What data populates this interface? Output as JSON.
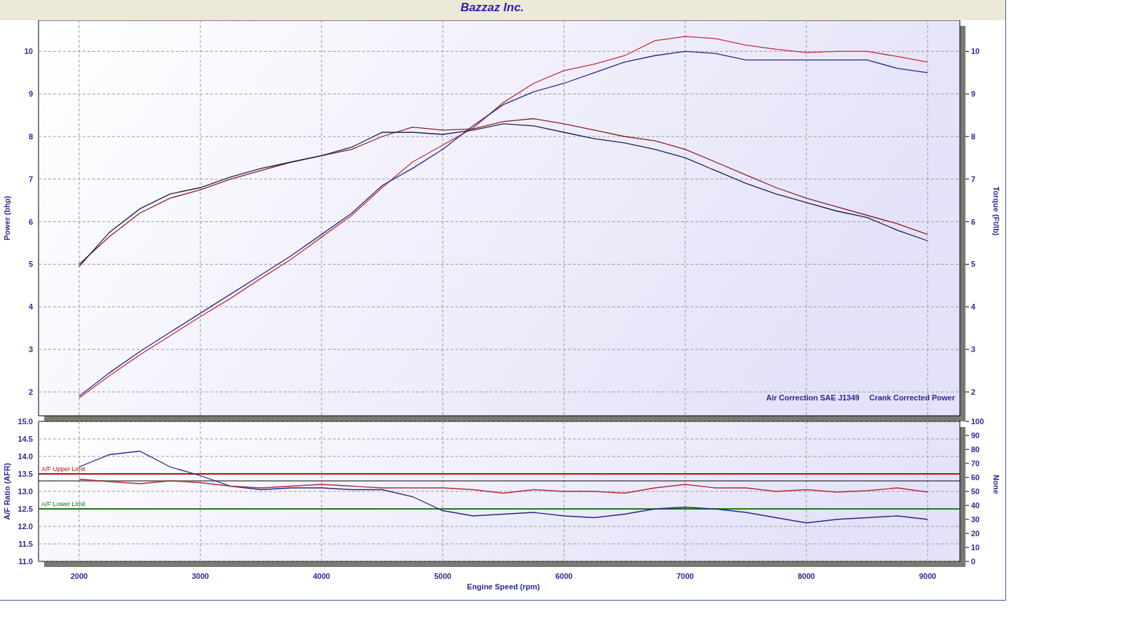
{
  "window": {
    "title": "Bazzaz Inc."
  },
  "power_chart": {
    "right_axis": {
      "label": "Torque (Ft/lb)",
      "ticks": [
        "10",
        "9",
        "8",
        "7",
        "6",
        "5",
        "4",
        "3",
        "2"
      ]
    },
    "notes": [
      "Air Correction SAE J1349",
      "Crank Corrected Power"
    ],
    "chart_data": {
      "type": "line",
      "ylabel": "Power (bhp)",
      "x": [
        2000,
        2250,
        2500,
        2750,
        3000,
        3250,
        3500,
        3750,
        4000,
        4250,
        4500,
        4750,
        5000,
        5250,
        5500,
        5750,
        6000,
        6250,
        6500,
        6750,
        7000,
        7250,
        7500,
        7750,
        8000,
        8250,
        8500,
        8750,
        9000
      ],
      "xlim": [
        1665,
        9266
      ],
      "ylim": [
        1.44,
        10.73
      ],
      "yticks": [
        2,
        3,
        4,
        5,
        6,
        7,
        8,
        9,
        10
      ],
      "grid": true,
      "series": [
        {
          "color": "#c42a3a",
          "values": [
            1.86,
            2.38,
            2.87,
            3.32,
            3.77,
            4.2,
            4.67,
            5.12,
            5.64,
            6.15,
            6.8,
            7.4,
            7.8,
            8.2,
            8.8,
            9.25,
            9.55,
            9.7,
            9.9,
            10.25,
            10.35,
            10.3,
            10.15,
            10.05,
            9.97,
            10.0,
            10.0,
            9.88,
            9.75
          ]
        },
        {
          "color": "#24248e",
          "values": [
            1.9,
            2.45,
            2.95,
            3.4,
            3.85,
            4.3,
            4.75,
            5.2,
            5.7,
            6.2,
            6.85,
            7.25,
            7.7,
            8.25,
            8.75,
            9.05,
            9.25,
            9.5,
            9.75,
            9.9,
            10.0,
            9.95,
            9.8,
            9.8,
            9.8,
            9.8,
            9.8,
            9.6,
            9.5
          ]
        },
        {
          "color": "#8a1c24",
          "values": [
            5.0,
            5.65,
            6.2,
            6.55,
            6.75,
            7.0,
            7.2,
            7.4,
            7.55,
            7.7,
            8.0,
            8.22,
            8.15,
            8.18,
            8.35,
            8.42,
            8.3,
            8.15,
            8.0,
            7.9,
            7.7,
            7.4,
            7.1,
            6.8,
            6.55,
            6.35,
            6.15,
            5.95,
            5.7
          ]
        },
        {
          "color": "#1c1c50",
          "values": [
            4.95,
            5.75,
            6.3,
            6.65,
            6.8,
            7.05,
            7.25,
            7.4,
            7.55,
            7.75,
            8.1,
            8.1,
            8.05,
            8.15,
            8.3,
            8.25,
            8.1,
            7.95,
            7.85,
            7.7,
            7.5,
            7.2,
            6.9,
            6.65,
            6.45,
            6.25,
            6.1,
            5.8,
            5.55
          ]
        }
      ]
    }
  },
  "afr_chart": {
    "right_axis": {
      "label": "None",
      "ticks": [
        "100",
        "90",
        "80",
        "70",
        "60",
        "50",
        "40",
        "30",
        "20",
        "10",
        "0"
      ]
    },
    "chart_data": {
      "type": "line",
      "xlabel": "Engine Speed (rpm)",
      "ylabel": "A/F Ratio (AFR)",
      "x": [
        2000,
        2250,
        2500,
        2750,
        3000,
        3250,
        3500,
        3750,
        4000,
        4250,
        4500,
        4750,
        5000,
        5250,
        5500,
        5750,
        6000,
        6250,
        6500,
        6750,
        7000,
        7250,
        7500,
        7750,
        8000,
        8250,
        8500,
        8750,
        9000
      ],
      "xlim": [
        1665,
        9266
      ],
      "ylim": [
        11,
        15
      ],
      "grid": true,
      "xticks": [
        2000,
        3000,
        4000,
        5000,
        6000,
        7000,
        8000,
        9000
      ],
      "yticks": [
        {
          "value": 11,
          "label": "11.0"
        },
        {
          "value": 11.5,
          "label": "11.5"
        },
        {
          "value": 12,
          "label": "12.0"
        },
        {
          "value": 12.5,
          "label": "12.5"
        },
        {
          "value": 13,
          "label": "13.0"
        },
        {
          "value": 13.5,
          "label": "13.5"
        },
        {
          "value": 14,
          "label": "14.0"
        },
        {
          "value": 14.5,
          "label": "14.5"
        },
        {
          "value": 15,
          "label": "15.0"
        }
      ],
      "series": [
        {
          "color": "#24248e",
          "values": [
            13.7,
            14.05,
            14.15,
            13.7,
            13.45,
            13.15,
            13.05,
            13.1,
            13.1,
            13.05,
            13.05,
            12.85,
            12.45,
            12.3,
            12.35,
            12.4,
            12.3,
            12.25,
            12.35,
            12.5,
            12.55,
            12.5,
            12.4,
            12.25,
            12.1,
            12.2,
            12.25,
            12.3,
            12.2
          ]
        },
        {
          "color": "#b22a34",
          "values": [
            13.35,
            13.28,
            13.22,
            13.3,
            13.25,
            13.15,
            13.1,
            13.15,
            13.2,
            13.15,
            13.1,
            13.1,
            13.1,
            13.05,
            12.95,
            13.05,
            13.0,
            13.0,
            12.95,
            13.1,
            13.2,
            13.1,
            13.1,
            13.0,
            13.05,
            12.98,
            13.02,
            13.1,
            12.98
          ]
        }
      ],
      "ref_lines": [
        {
          "axis": "y",
          "value": 13.5,
          "label": "A/F Upper Limit",
          "color": "#b01010"
        },
        {
          "axis": "y",
          "value": 13.3,
          "color": "#000000"
        },
        {
          "axis": "y",
          "value": 12.5,
          "label": "A/F Lower Limit",
          "color": "#108010"
        }
      ]
    }
  }
}
